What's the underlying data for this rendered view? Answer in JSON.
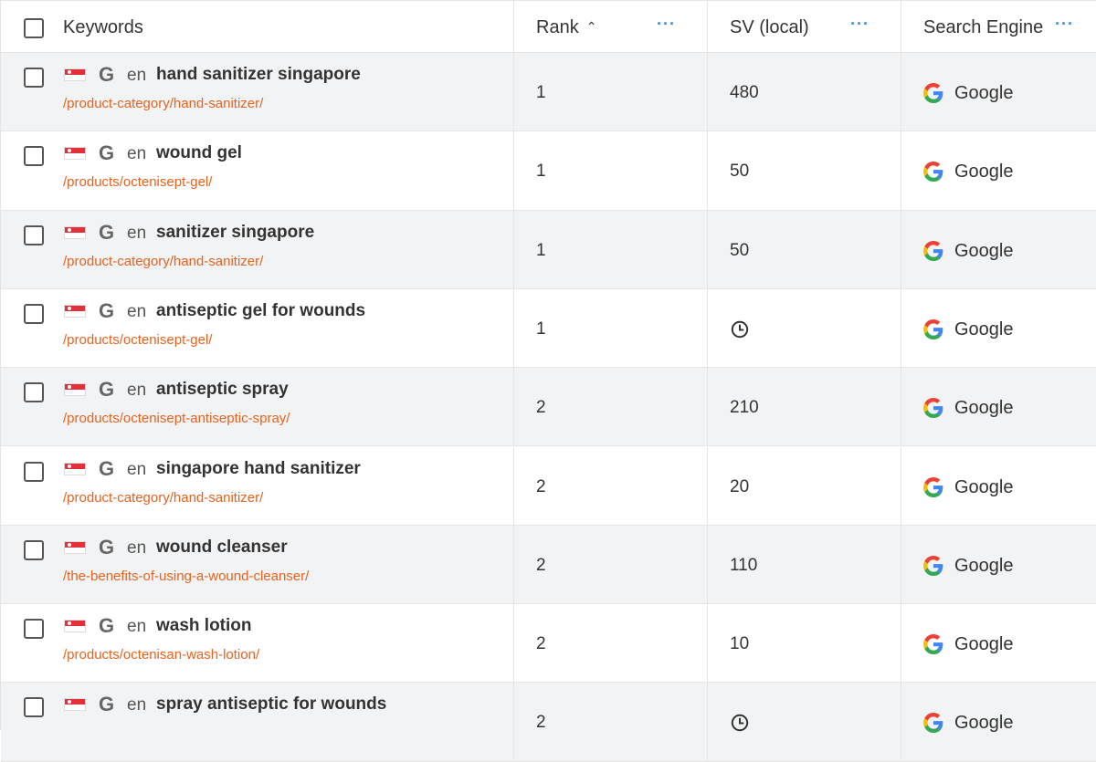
{
  "header": {
    "keywords": "Keywords",
    "rank": "Rank",
    "rank_sort_icon": "chevron-up-icon",
    "sv": "SV (local)",
    "search_engine": "Search Engine",
    "menu_dots": "···"
  },
  "colors": {
    "url_orange": "#e8621c",
    "menu_blue": "#3d8be0",
    "row_shade": "#f2f3f4"
  },
  "rows": [
    {
      "lang": "en",
      "keyword": "hand sanitizer singapore",
      "url": "/product-category/hand-sanitizer/",
      "rank": "1",
      "sv": "480",
      "engine": "Google",
      "shaded": true
    },
    {
      "lang": "en",
      "keyword": "wound gel",
      "url": "/products/octenisept-gel/",
      "rank": "1",
      "sv": "50",
      "engine": "Google",
      "shaded": false
    },
    {
      "lang": "en",
      "keyword": "sanitizer singapore",
      "url": "/product-category/hand-sanitizer/",
      "rank": "1",
      "sv": "50",
      "engine": "Google",
      "shaded": true
    },
    {
      "lang": "en",
      "keyword": "antiseptic gel for wounds",
      "url": "/products/octenisept-gel/",
      "rank": "1",
      "sv": "",
      "sv_pending": true,
      "engine": "Google",
      "shaded": false
    },
    {
      "lang": "en",
      "keyword": "antiseptic spray",
      "url": "/products/octenisept-antiseptic-spray/",
      "rank": "2",
      "sv": "210",
      "engine": "Google",
      "shaded": true
    },
    {
      "lang": "en",
      "keyword": "singapore hand sanitizer",
      "url": "/product-category/hand-sanitizer/",
      "rank": "2",
      "sv": "20",
      "engine": "Google",
      "shaded": false
    },
    {
      "lang": "en",
      "keyword": "wound cleanser",
      "url": "/the-benefits-of-using-a-wound-cleanser/",
      "rank": "2",
      "sv": "110",
      "engine": "Google",
      "shaded": true
    },
    {
      "lang": "en",
      "keyword": "wash lotion",
      "url": "/products/octenisan-wash-lotion/",
      "rank": "2",
      "sv": "10",
      "engine": "Google",
      "shaded": false
    },
    {
      "lang": "en",
      "keyword": "spray antiseptic for wounds",
      "url": "",
      "rank": "2",
      "sv": "",
      "sv_pending": true,
      "engine": "Google",
      "shaded": true
    }
  ]
}
